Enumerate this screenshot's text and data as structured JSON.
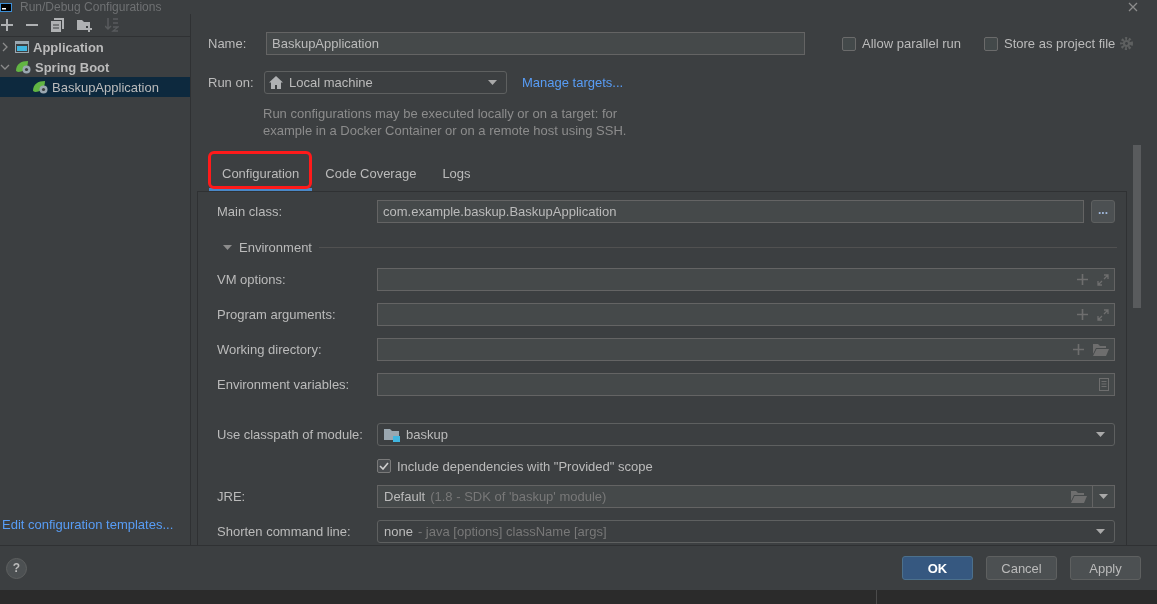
{
  "window": {
    "title": "Run/Debug Configurations"
  },
  "sidebar": {
    "toolbar": [
      {
        "kind": "add",
        "disabled": false
      },
      {
        "kind": "remove",
        "disabled": false
      },
      {
        "kind": "copy",
        "disabled": false
      },
      {
        "kind": "folder",
        "disabled": false
      },
      {
        "kind": "sort",
        "disabled": true
      }
    ],
    "tree": [
      {
        "label": "Application",
        "kind": "application",
        "expanded": false,
        "selected": false
      },
      {
        "label": "Spring Boot",
        "kind": "spring-boot",
        "expanded": true,
        "selected": false,
        "children": [
          {
            "label": "BaskupApplication",
            "kind": "spring-boot",
            "selected": true
          }
        ]
      }
    ],
    "templates_link": "Edit configuration templates..."
  },
  "name": {
    "label": "Name:",
    "value": "BaskupApplication"
  },
  "options": [
    {
      "label": "Allow parallel run",
      "checked": false
    },
    {
      "label": "Store as project file",
      "checked": false
    }
  ],
  "run_on": {
    "label": "Run on:",
    "value": "Local machine",
    "link": "Manage targets..."
  },
  "description": "Run configurations may be executed locally or on a target: for example in a Docker Container or on a remote host using SSH.",
  "tabs": [
    {
      "label": "Configuration",
      "selected": true,
      "highlighted": true
    },
    {
      "label": "Code Coverage",
      "selected": false,
      "highlighted": false
    },
    {
      "label": "Logs",
      "selected": false,
      "highlighted": false
    }
  ],
  "configuration": {
    "main_class": {
      "label": "Main class:",
      "value": "com.example.baskup.BaskupApplication",
      "browse_button": "..."
    },
    "environment": {
      "title": "Environment",
      "expanded": true,
      "fields": [
        {
          "label": "VM options:",
          "kind": "expandable"
        },
        {
          "label": "Program arguments:",
          "kind": "expandable"
        },
        {
          "label": "Working directory:",
          "kind": "directory"
        },
        {
          "label": "Environment variables:",
          "kind": "variables"
        }
      ]
    },
    "module": {
      "label": "Use classpath of module:",
      "value": "baskup"
    },
    "include_provided": {
      "label": "Include dependencies with \"Provided\" scope",
      "checked": true
    },
    "jre": {
      "label": "JRE:",
      "value": "Default",
      "hint": "(1.8 - SDK of 'baskup' module)"
    },
    "shorten_command_line": {
      "label": "Shorten command line:",
      "value": "none",
      "hint": "- java [options] className [args]"
    }
  },
  "footer": {
    "help": "?",
    "buttons": [
      {
        "label": "OK",
        "kind": "default"
      },
      {
        "label": "Cancel",
        "kind": "normal"
      },
      {
        "label": "Apply",
        "kind": "normal"
      }
    ]
  }
}
